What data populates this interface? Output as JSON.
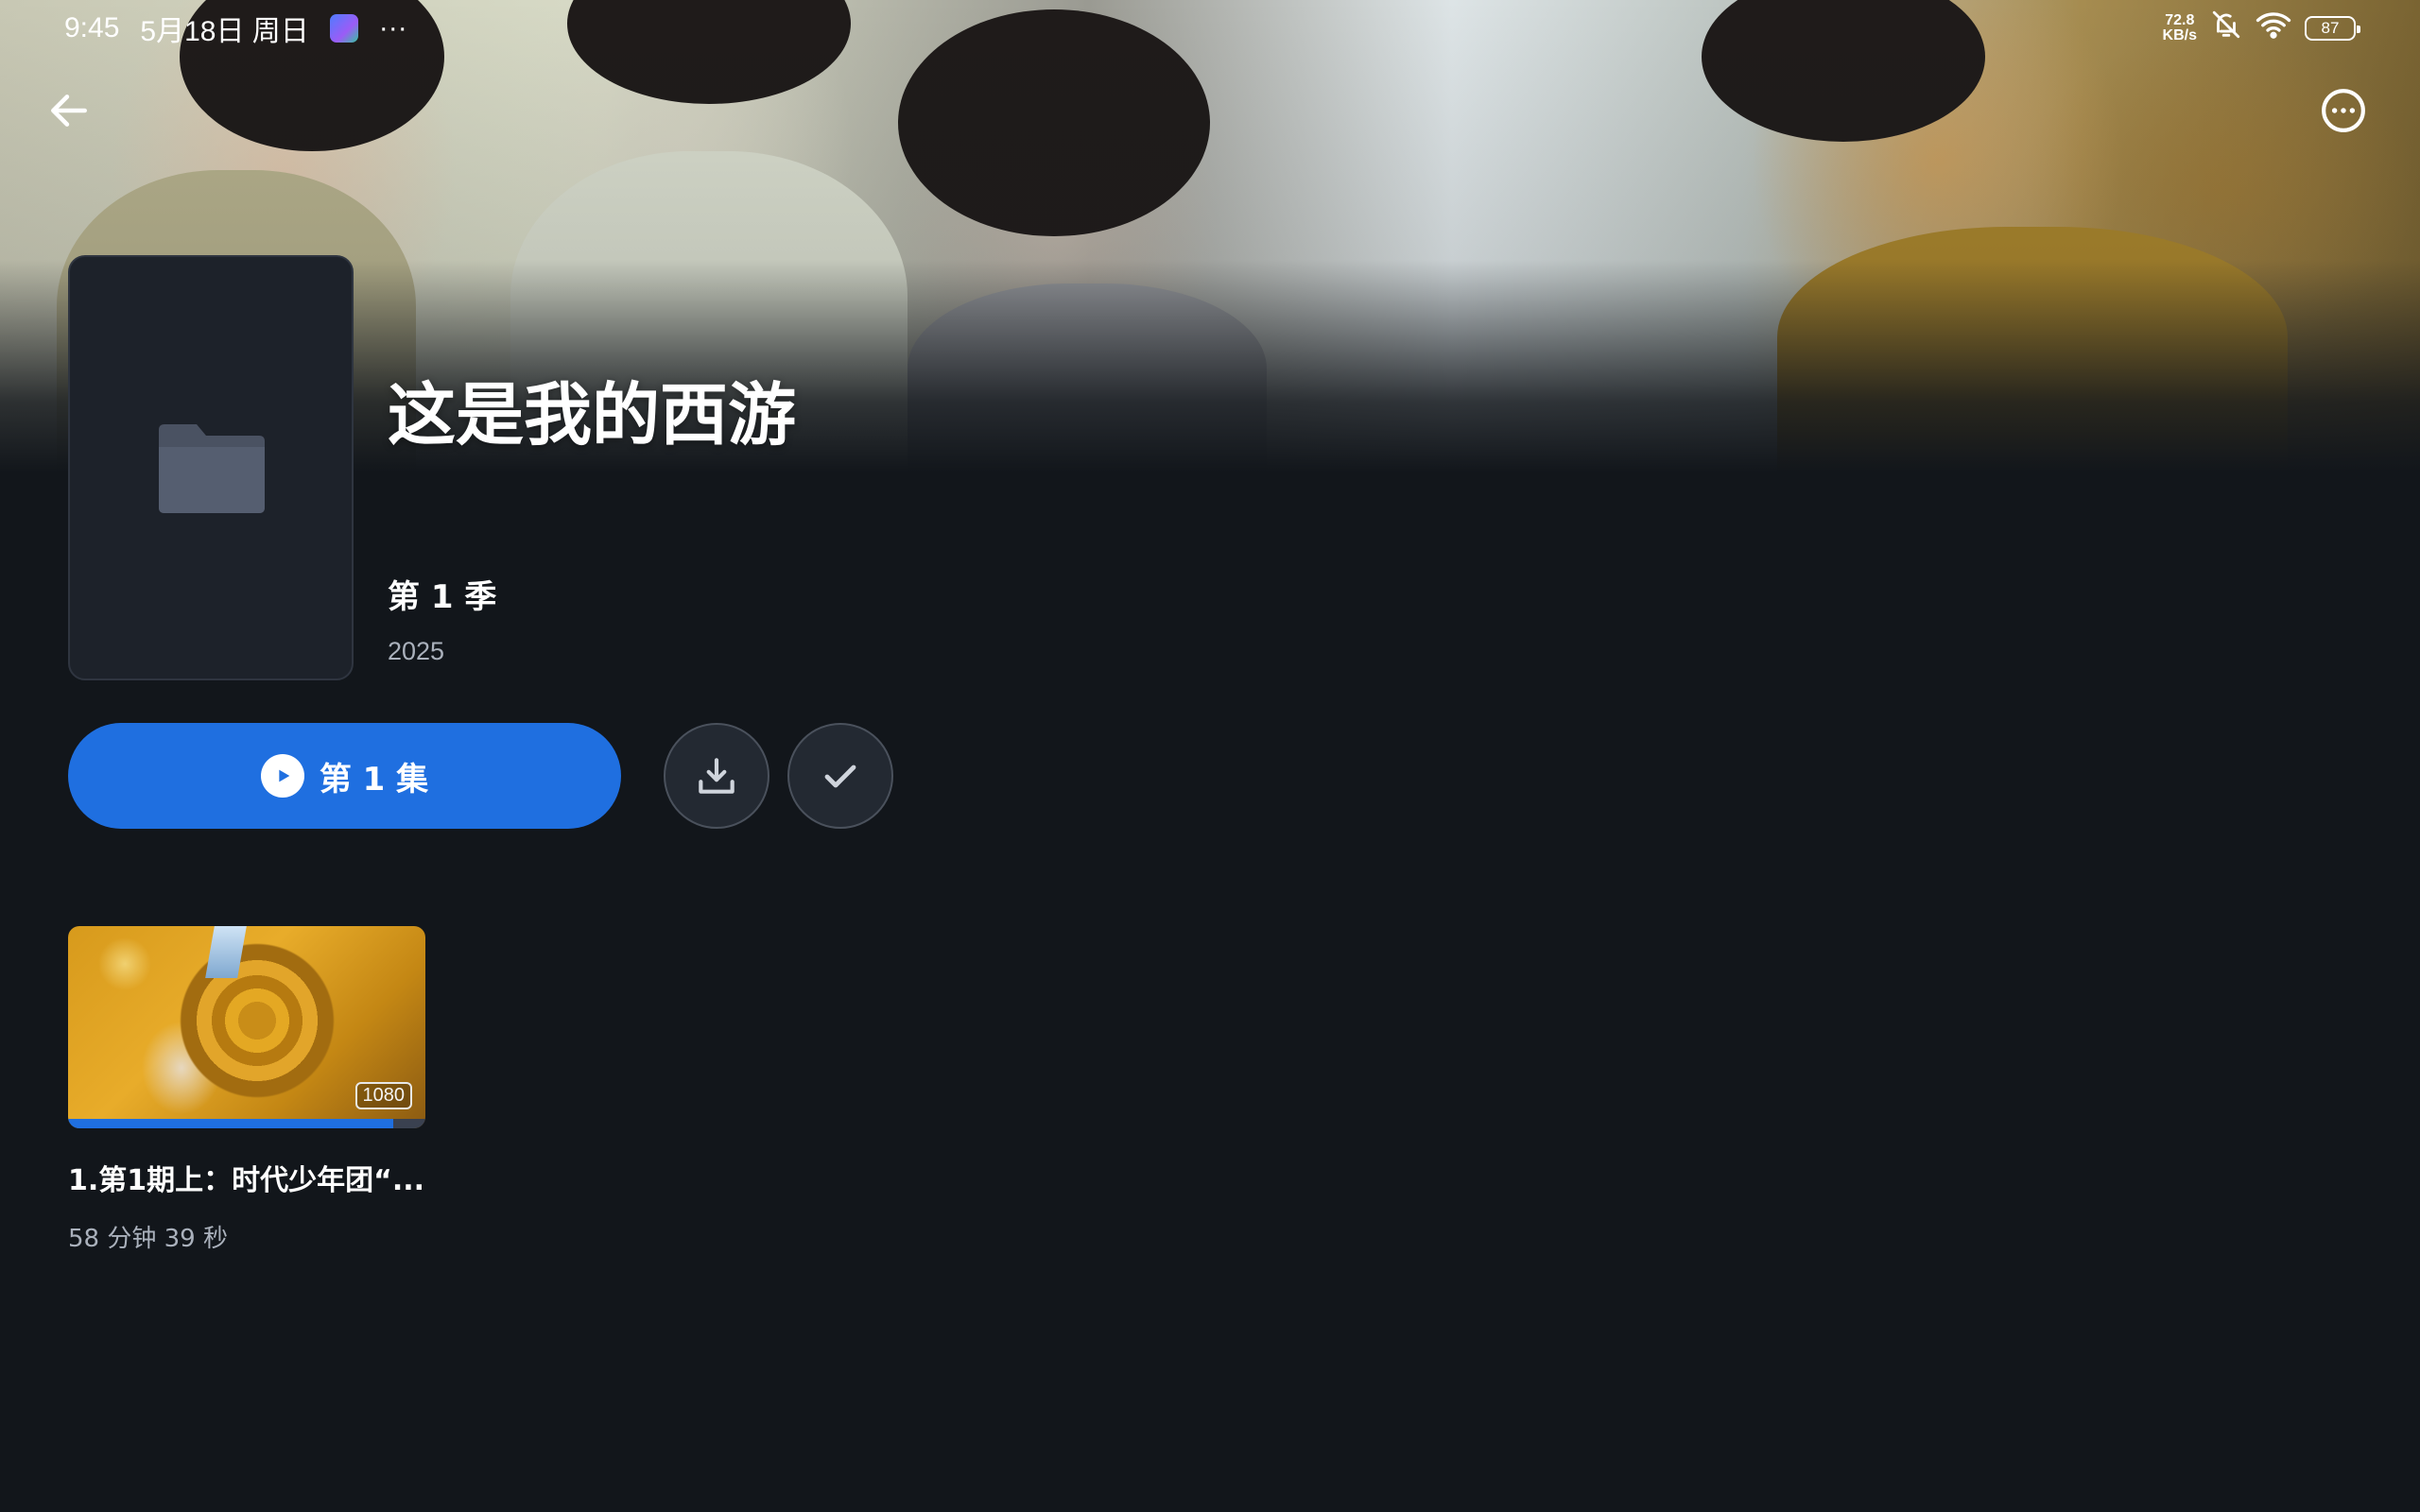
{
  "status_bar": {
    "time": "9:45",
    "date": "5月18日 周日",
    "more": "···",
    "net_speed_value": "72.8",
    "net_speed_unit": "KB/s",
    "battery": "87"
  },
  "show": {
    "title": "这是我的西游",
    "season": "第 1 季",
    "year": "2025"
  },
  "actions": {
    "play_label": "第 1 集",
    "download_icon": "download-icon",
    "watched_icon": "check-icon"
  },
  "episodes": [
    {
      "title": "1.第1期上：时代少年团“...",
      "duration": "58 分钟 39 秒",
      "quality_badge": "1080",
      "progress_percent": 91
    }
  ],
  "colors": {
    "background": "#12161b",
    "accent": "#1f6fe0",
    "secondary_text": "#aab1bc"
  }
}
